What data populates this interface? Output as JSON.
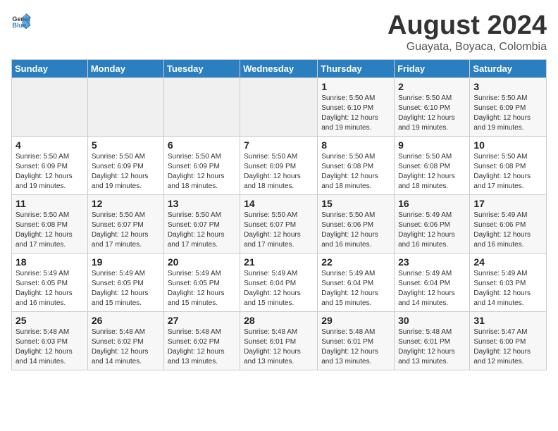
{
  "header": {
    "logo_general": "General",
    "logo_blue": "Blue",
    "title": "August 2024",
    "subtitle": "Guayata, Boyaca, Colombia"
  },
  "weekdays": [
    "Sunday",
    "Monday",
    "Tuesday",
    "Wednesday",
    "Thursday",
    "Friday",
    "Saturday"
  ],
  "weeks": [
    [
      {
        "day": "",
        "info": ""
      },
      {
        "day": "",
        "info": ""
      },
      {
        "day": "",
        "info": ""
      },
      {
        "day": "",
        "info": ""
      },
      {
        "day": "1",
        "info": "Sunrise: 5:50 AM\nSunset: 6:10 PM\nDaylight: 12 hours\nand 19 minutes."
      },
      {
        "day": "2",
        "info": "Sunrise: 5:50 AM\nSunset: 6:10 PM\nDaylight: 12 hours\nand 19 minutes."
      },
      {
        "day": "3",
        "info": "Sunrise: 5:50 AM\nSunset: 6:09 PM\nDaylight: 12 hours\nand 19 minutes."
      }
    ],
    [
      {
        "day": "4",
        "info": "Sunrise: 5:50 AM\nSunset: 6:09 PM\nDaylight: 12 hours\nand 19 minutes."
      },
      {
        "day": "5",
        "info": "Sunrise: 5:50 AM\nSunset: 6:09 PM\nDaylight: 12 hours\nand 19 minutes."
      },
      {
        "day": "6",
        "info": "Sunrise: 5:50 AM\nSunset: 6:09 PM\nDaylight: 12 hours\nand 18 minutes."
      },
      {
        "day": "7",
        "info": "Sunrise: 5:50 AM\nSunset: 6:09 PM\nDaylight: 12 hours\nand 18 minutes."
      },
      {
        "day": "8",
        "info": "Sunrise: 5:50 AM\nSunset: 6:08 PM\nDaylight: 12 hours\nand 18 minutes."
      },
      {
        "day": "9",
        "info": "Sunrise: 5:50 AM\nSunset: 6:08 PM\nDaylight: 12 hours\nand 18 minutes."
      },
      {
        "day": "10",
        "info": "Sunrise: 5:50 AM\nSunset: 6:08 PM\nDaylight: 12 hours\nand 17 minutes."
      }
    ],
    [
      {
        "day": "11",
        "info": "Sunrise: 5:50 AM\nSunset: 6:08 PM\nDaylight: 12 hours\nand 17 minutes."
      },
      {
        "day": "12",
        "info": "Sunrise: 5:50 AM\nSunset: 6:07 PM\nDaylight: 12 hours\nand 17 minutes."
      },
      {
        "day": "13",
        "info": "Sunrise: 5:50 AM\nSunset: 6:07 PM\nDaylight: 12 hours\nand 17 minutes."
      },
      {
        "day": "14",
        "info": "Sunrise: 5:50 AM\nSunset: 6:07 PM\nDaylight: 12 hours\nand 17 minutes."
      },
      {
        "day": "15",
        "info": "Sunrise: 5:50 AM\nSunset: 6:06 PM\nDaylight: 12 hours\nand 16 minutes."
      },
      {
        "day": "16",
        "info": "Sunrise: 5:49 AM\nSunset: 6:06 PM\nDaylight: 12 hours\nand 16 minutes."
      },
      {
        "day": "17",
        "info": "Sunrise: 5:49 AM\nSunset: 6:06 PM\nDaylight: 12 hours\nand 16 minutes."
      }
    ],
    [
      {
        "day": "18",
        "info": "Sunrise: 5:49 AM\nSunset: 6:05 PM\nDaylight: 12 hours\nand 16 minutes."
      },
      {
        "day": "19",
        "info": "Sunrise: 5:49 AM\nSunset: 6:05 PM\nDaylight: 12 hours\nand 15 minutes."
      },
      {
        "day": "20",
        "info": "Sunrise: 5:49 AM\nSunset: 6:05 PM\nDaylight: 12 hours\nand 15 minutes."
      },
      {
        "day": "21",
        "info": "Sunrise: 5:49 AM\nSunset: 6:04 PM\nDaylight: 12 hours\nand 15 minutes."
      },
      {
        "day": "22",
        "info": "Sunrise: 5:49 AM\nSunset: 6:04 PM\nDaylight: 12 hours\nand 15 minutes."
      },
      {
        "day": "23",
        "info": "Sunrise: 5:49 AM\nSunset: 6:04 PM\nDaylight: 12 hours\nand 14 minutes."
      },
      {
        "day": "24",
        "info": "Sunrise: 5:49 AM\nSunset: 6:03 PM\nDaylight: 12 hours\nand 14 minutes."
      }
    ],
    [
      {
        "day": "25",
        "info": "Sunrise: 5:48 AM\nSunset: 6:03 PM\nDaylight: 12 hours\nand 14 minutes."
      },
      {
        "day": "26",
        "info": "Sunrise: 5:48 AM\nSunset: 6:02 PM\nDaylight: 12 hours\nand 14 minutes."
      },
      {
        "day": "27",
        "info": "Sunrise: 5:48 AM\nSunset: 6:02 PM\nDaylight: 12 hours\nand 13 minutes."
      },
      {
        "day": "28",
        "info": "Sunrise: 5:48 AM\nSunset: 6:01 PM\nDaylight: 12 hours\nand 13 minutes."
      },
      {
        "day": "29",
        "info": "Sunrise: 5:48 AM\nSunset: 6:01 PM\nDaylight: 12 hours\nand 13 minutes."
      },
      {
        "day": "30",
        "info": "Sunrise: 5:48 AM\nSunset: 6:01 PM\nDaylight: 12 hours\nand 13 minutes."
      },
      {
        "day": "31",
        "info": "Sunrise: 5:47 AM\nSunset: 6:00 PM\nDaylight: 12 hours\nand 12 minutes."
      }
    ]
  ]
}
